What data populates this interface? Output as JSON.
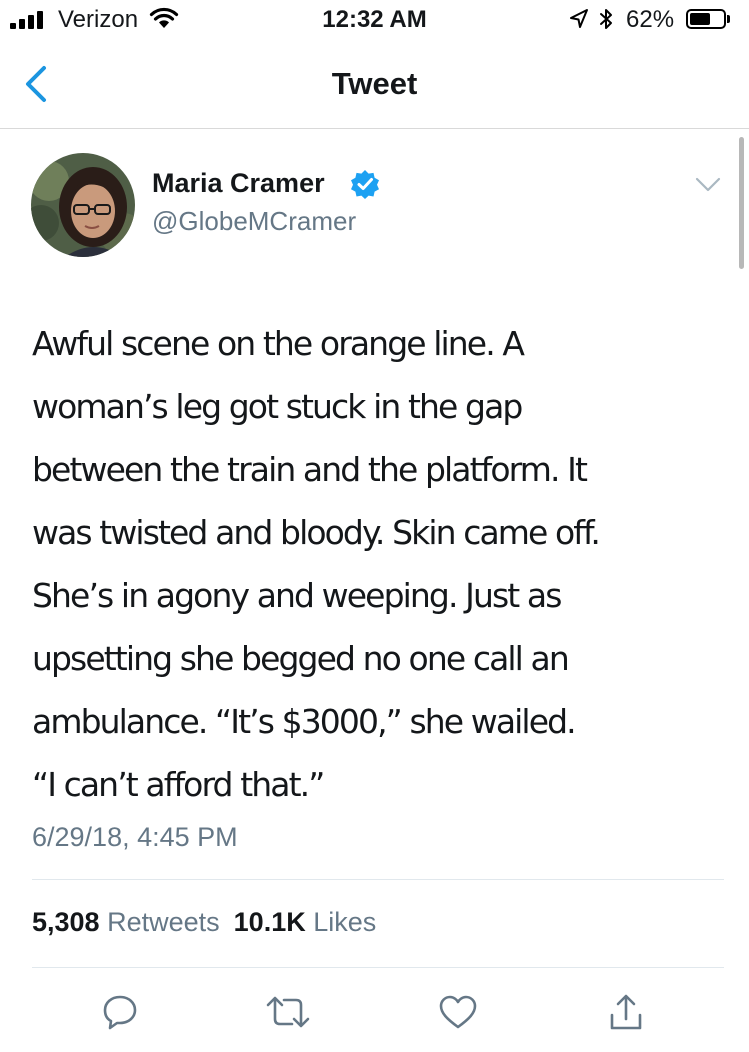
{
  "status_bar": {
    "carrier": "Verizon",
    "time": "12:32 AM",
    "battery_percent": "62%",
    "battery_level": 0.62,
    "signal_bars": 4,
    "icons": [
      "signal-icon",
      "wifi-icon",
      "location-arrow-icon",
      "bluetooth-icon",
      "battery-icon"
    ]
  },
  "nav": {
    "title": "Tweet",
    "back_icon": "chevron-left-icon"
  },
  "tweet": {
    "author": {
      "name": "Maria Cramer",
      "handle": "@GlobeMCramer",
      "verified": true
    },
    "text": "Awful scene on the orange line. A\nwoman’s leg got stuck in the gap\nbetween the train and the platform. It\nwas twisted and bloody. Skin came off.\nShe’s in agony and weeping. Just as\nupsetting she begged no one call an\nambulance. “It’s $3000,” she wailed.\n“I can’t afford that.”",
    "timestamp": "6/29/18, 4:45 PM",
    "stats": {
      "retweets_count": "5,308",
      "retweets_label": "Retweets",
      "likes_count": "10.1K",
      "likes_label": "Likes"
    },
    "actions": [
      "reply-icon",
      "retweet-icon",
      "like-icon",
      "share-icon"
    ]
  },
  "colors": {
    "text": "#14171a",
    "secondary": "#657786",
    "accent": "#1da1f2",
    "back_arrow": "#1b95e0",
    "action_icons": "#657786",
    "divider": "#e1e8ed"
  }
}
